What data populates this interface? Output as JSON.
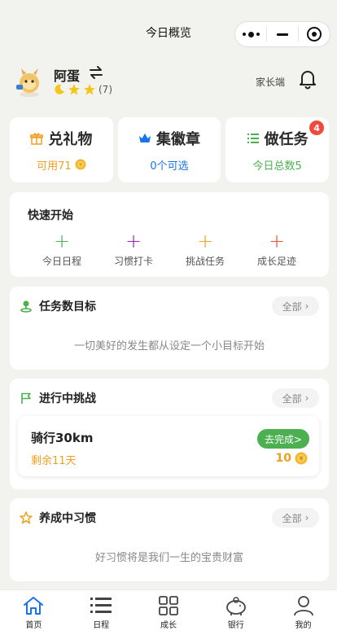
{
  "header": {
    "title": "今日概览"
  },
  "profile": {
    "name": "阿蛋",
    "rating_count": "(7)",
    "parent_mode": "家长端"
  },
  "cards": [
    {
      "title": "兑礼物",
      "sub": "可用71",
      "color": "#f0a020"
    },
    {
      "title": "集徽章",
      "sub": "0个可选",
      "color": "#1a73e8"
    },
    {
      "title": "做任务",
      "sub": "今日总数5",
      "color": "#4caf50",
      "badge": "4"
    }
  ],
  "quick": {
    "title": "快速开始",
    "items": [
      {
        "label": "今日日程",
        "color": "#4caf50"
      },
      {
        "label": "习惯打卡",
        "color": "#a020c0"
      },
      {
        "label": "挑战任务",
        "color": "#f0a020"
      },
      {
        "label": "成长足迹",
        "color": "#f05030"
      }
    ]
  },
  "goal": {
    "title": "任务数目标",
    "all_label": "全部",
    "empty": "一切美好的发生都从设定一个小目标开始"
  },
  "challenge": {
    "title": "进行中挑战",
    "all_label": "全部",
    "item": {
      "name": "骑行30km",
      "remaining": "剩余11天",
      "action": "去完成>",
      "reward": "10"
    }
  },
  "habit": {
    "title": "养成中习惯",
    "all_label": "全部",
    "empty": "好习惯将是我们一生的宝贵财富"
  },
  "tabs": [
    {
      "label": "首页",
      "icon": "home-icon",
      "active": true
    },
    {
      "label": "日程",
      "icon": "list-icon"
    },
    {
      "label": "成长",
      "icon": "grid-icon"
    },
    {
      "label": "银行",
      "icon": "piggy-bank-icon"
    },
    {
      "label": "我的",
      "icon": "user-icon"
    }
  ],
  "colors": {
    "accent_green": "#4caf50",
    "accent_orange": "#f0a020",
    "accent_blue": "#1a73e8",
    "badge_red": "#f04a3e",
    "tab_active": "#1a73e8"
  }
}
